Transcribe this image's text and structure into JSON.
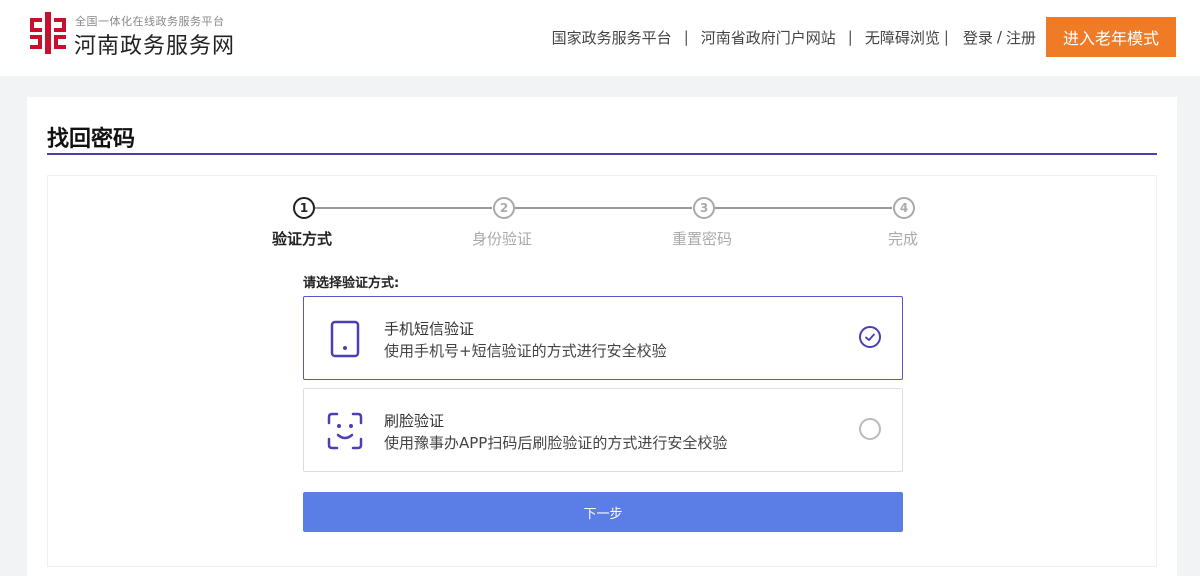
{
  "header": {
    "logo_tagline": "全国一体化在线政务服务平台",
    "logo_title": "河南政务服务网",
    "nav": {
      "national_platform": "国家政务服务平台",
      "provincial_portal": "河南省政府门户网站",
      "accessible": "无障碍浏览",
      "login": "登录",
      "slash": "/",
      "register": "注册",
      "elder_mode": "进入老年模式"
    }
  },
  "page": {
    "title": "找回密码",
    "steps": [
      {
        "number": "1",
        "label": "验证方式",
        "active": true
      },
      {
        "number": "2",
        "label": "身份验证",
        "active": false
      },
      {
        "number": "3",
        "label": "重置密码",
        "active": false
      },
      {
        "number": "4",
        "label": "完成",
        "active": false
      }
    ],
    "prompt": "请选择验证方式:",
    "options": [
      {
        "title": "手机短信验证",
        "desc": "使用手机号+短信验证的方式进行安全校验",
        "icon": "phone-icon",
        "selected": true
      },
      {
        "title": "刷脸验证",
        "desc": "使用豫事办APP扫码后刷脸验证的方式进行安全校验",
        "icon": "face-scan-icon",
        "selected": false
      }
    ],
    "next_label": "下一步"
  },
  "colors": {
    "accent": "#4b3fb6",
    "elder_button": "#f07b27",
    "next_button": "#5a7ee6",
    "logo": "#c8102e"
  }
}
